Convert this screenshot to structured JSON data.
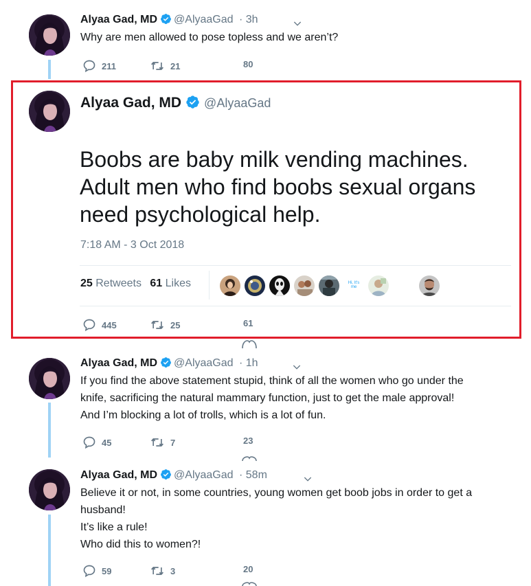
{
  "author": {
    "name": "Alyaa Gad, MD",
    "handle": "@AlyaaGad"
  },
  "tweets": [
    {
      "time": "· 3h",
      "lines": [
        "Why are men allowed to pose topless and we aren’t?"
      ],
      "replies": "211",
      "retweets": "21",
      "likes": "80"
    },
    {
      "focused": true,
      "lines": [
        "Boobs are baby milk vending machines.",
        "Adult men who find boobs sexual organs",
        "need psychological help."
      ],
      "date": "7:18 AM - 3 Oct 2018",
      "retweet_count": "25",
      "retweet_word": "Retweets",
      "like_count": "61",
      "like_word": "Likes",
      "liker_avatars": [
        "liker-1",
        "liker-2",
        "liker-3",
        "liker-4",
        "liker-5",
        "liker-6",
        "liker-7",
        "liker-8"
      ],
      "liker_6_text": "Hi, It's me",
      "replies": "445",
      "retweets": "25",
      "likes": "61"
    },
    {
      "time": "· 1h",
      "lines": [
        "If you find the above statement stupid, think of all the women who go under the",
        "knife, sacrificing the natural mammary function, just to get the male approval!",
        "And I’m blocking a lot of trolls, which is a lot of fun."
      ],
      "replies": "45",
      "retweets": "7",
      "likes": "23"
    },
    {
      "time": "· 58m",
      "lines": [
        "Believe it or not, in some countries, young women get boob jobs in order to get a",
        "husband!",
        "It’s like a rule!",
        "Who did this to women?!"
      ],
      "replies": "59",
      "retweets": "3",
      "likes": "20"
    }
  ],
  "icons": {
    "verified": "verified-badge-icon",
    "reply": "reply-icon",
    "retweet": "retweet-icon",
    "like": "heart-icon",
    "more": "chevron-down-icon"
  },
  "colors": {
    "text": "#14171a",
    "muted": "#657786",
    "verified": "#1da1f2",
    "thread": "#9fd3f5",
    "highlight": "#e11d2b"
  }
}
